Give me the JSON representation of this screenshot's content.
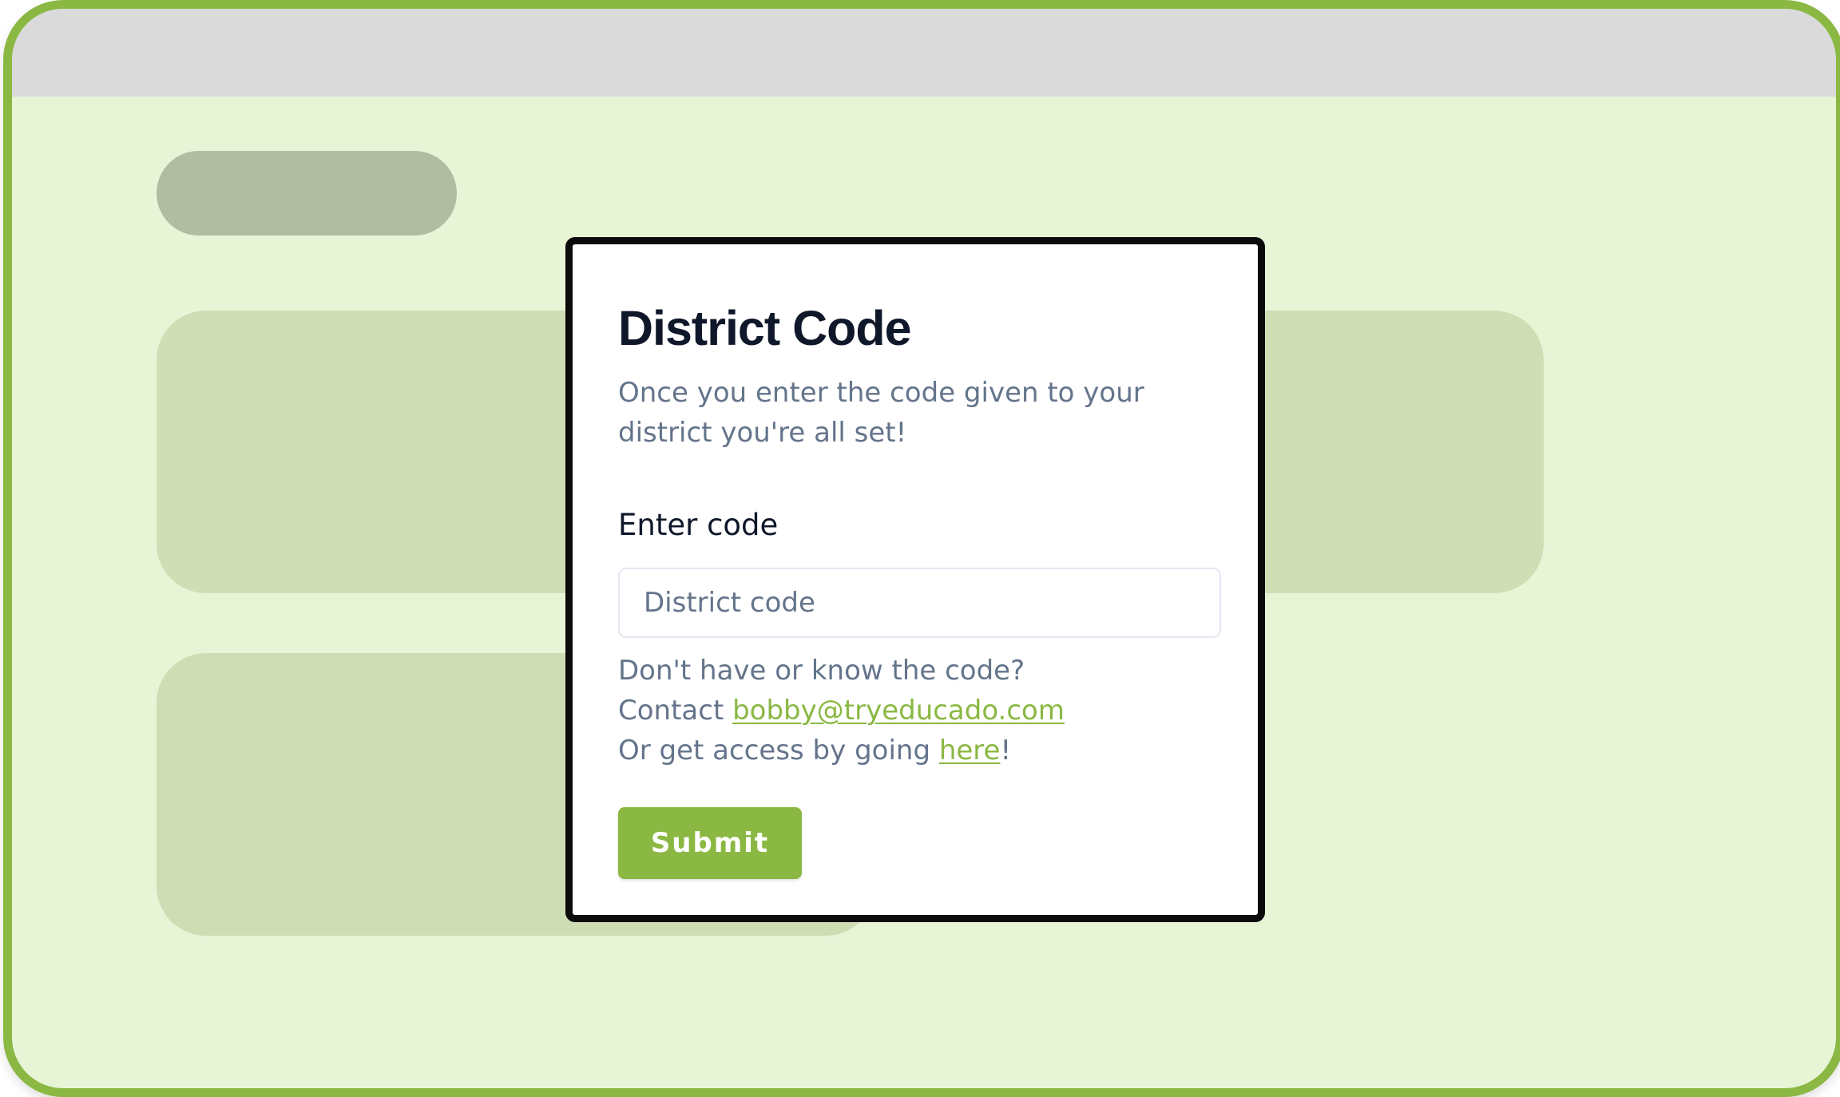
{
  "theme": {
    "accent": "#8ab843",
    "page_background": "#e8f4d6",
    "top_bar": "#dadada",
    "text_dark": "#0f172a",
    "text_muted": "#64748b"
  },
  "modal": {
    "title": "District Code",
    "description": "Once you enter the code given to your district you're all set!",
    "field_label": "Enter code",
    "input": {
      "value": "",
      "placeholder": "District code"
    },
    "help": {
      "line1": "Don't have or know the code?",
      "contact_prefix": "Contact ",
      "contact_email": "bobby@tryeducado.com",
      "access_prefix": "Or get access by going ",
      "access_link": "here",
      "access_suffix": "!"
    },
    "submit_label": "Submit"
  }
}
